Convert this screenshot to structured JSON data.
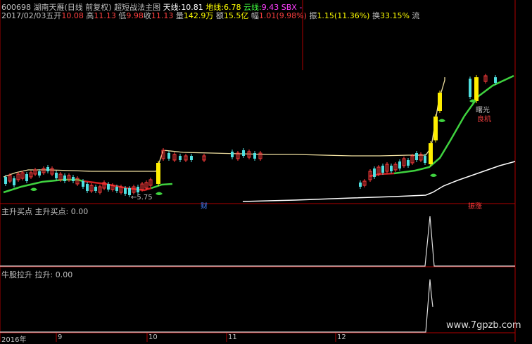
{
  "header": {
    "code": "600698",
    "name": "湖南天雁(日线 前复权)",
    "indicator": "超短战法主图",
    "tianxian_label": "天线:",
    "tianxian_value": "10.81",
    "dixian_label": "地线:",
    "dixian_value": "6.78",
    "yunxian_label": "云线:",
    "yunxian_value": "9.43",
    "sbx_label": "SBX",
    "sbx_dash": "-"
  },
  "quote": {
    "date": "2017/02/03五",
    "open_label": "开",
    "open": "10.08",
    "high_label": "高",
    "high": "11.13",
    "low_label": "低",
    "low": "9.98",
    "close_label": "收",
    "close": "11.13",
    "vol_label": "量",
    "vol": "142.9万",
    "amount_label": "额",
    "amount": "15.5亿",
    "chg_label": "幅",
    "chg": "1.01(9.98%)",
    "amp_label": "振",
    "amp": "1.15(11.36%)",
    "turnover_label": "换",
    "turnover": "33.15%",
    "flow_label": "流"
  },
  "annotations": {
    "low_price": "←5.75",
    "cai": "财",
    "shugu": "曙光",
    "liangji": "良机",
    "zhenzhang": "振涨"
  },
  "panel2": {
    "title": "主升买点",
    "value_label": "主升买点: 0.00"
  },
  "panel3": {
    "title": "牛股拉升",
    "value_label": "拉升: 0.00"
  },
  "xaxis": {
    "labels": [
      "2016年",
      "9",
      "10",
      "11",
      "12"
    ]
  },
  "watermark": "www.7gpzb.com",
  "colors": {
    "up": "#ff3c3c",
    "down": "#4fe0e0",
    "green_line": "#3fd23f",
    "red_line": "#d02020",
    "yellow_candle": "#ffee00",
    "resistance": "#f0e0a0",
    "white_line": "#ffffff",
    "axis": "#b00000",
    "header_yellow": "#ffff00",
    "header_magenta": "#ff40ff",
    "header_green": "#40ff40"
  }
}
